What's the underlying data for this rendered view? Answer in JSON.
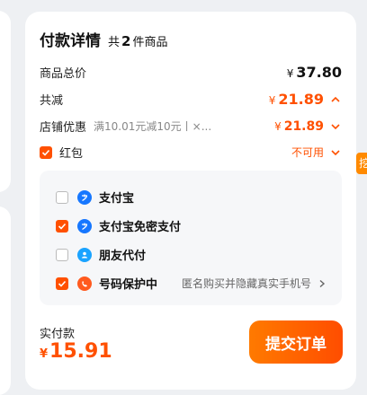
{
  "header": {
    "title": "付款详情",
    "count_prefix": "共",
    "count": "2",
    "count_suffix": "件商品"
  },
  "summary": {
    "goods_total": {
      "label": "商品总价",
      "currency": "¥",
      "value": "37.80"
    },
    "discount": {
      "label": "共减",
      "currency": "¥",
      "value": "21.89"
    },
    "store_discount": {
      "label": "店铺优惠",
      "detail": "满10.01元减10元丨×...",
      "currency": "¥",
      "value": "21.89"
    },
    "red_packet": {
      "label": "红包",
      "status": "不可用"
    }
  },
  "payment_options": [
    {
      "label": "支付宝",
      "checked": false,
      "icon": "alipay-icon"
    },
    {
      "label": "支付宝免密支付",
      "checked": true,
      "icon": "alipay-icon"
    },
    {
      "label": "朋友代付",
      "checked": false,
      "icon": "friend-pay-icon"
    },
    {
      "label": "号码保护中",
      "checked": true,
      "icon": "number-protection-icon",
      "tail": "匿名购买并隐藏真实手机号"
    }
  ],
  "footer": {
    "total_label": "实付款",
    "currency": "¥",
    "total": "15.91",
    "submit_label": "提交订单"
  },
  "side_tab": {
    "label": "挖"
  },
  "colors": {
    "accent": "#ff5000",
    "alipay": "#1677ff"
  }
}
